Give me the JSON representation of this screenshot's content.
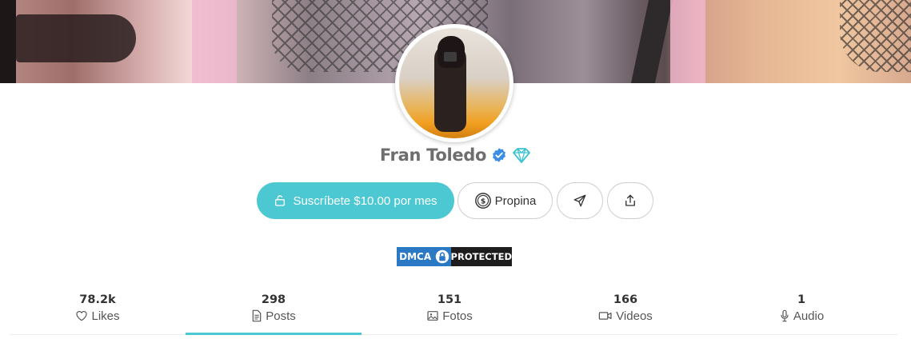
{
  "profile": {
    "name": "Fran Toledo",
    "subscribe_label": "Suscríbete $10.00 por mes",
    "tip_label": "Propina"
  },
  "badge": {
    "left": "DMCA",
    "right": "PROTECTED"
  },
  "stats": [
    {
      "value": "78.2k",
      "label": "Likes",
      "icon": "heart-icon"
    },
    {
      "value": "298",
      "label": "Posts",
      "icon": "document-icon"
    },
    {
      "value": "151",
      "label": "Fotos",
      "icon": "image-icon"
    },
    {
      "value": "166",
      "label": "Videos",
      "icon": "video-icon"
    },
    {
      "value": "1",
      "label": "Audio",
      "icon": "microphone-icon"
    }
  ],
  "active_tab": "Posts",
  "colors": {
    "accent": "#4cc8d3",
    "verified": "#3b8ee8",
    "dmca_blue": "#2b78c5"
  }
}
